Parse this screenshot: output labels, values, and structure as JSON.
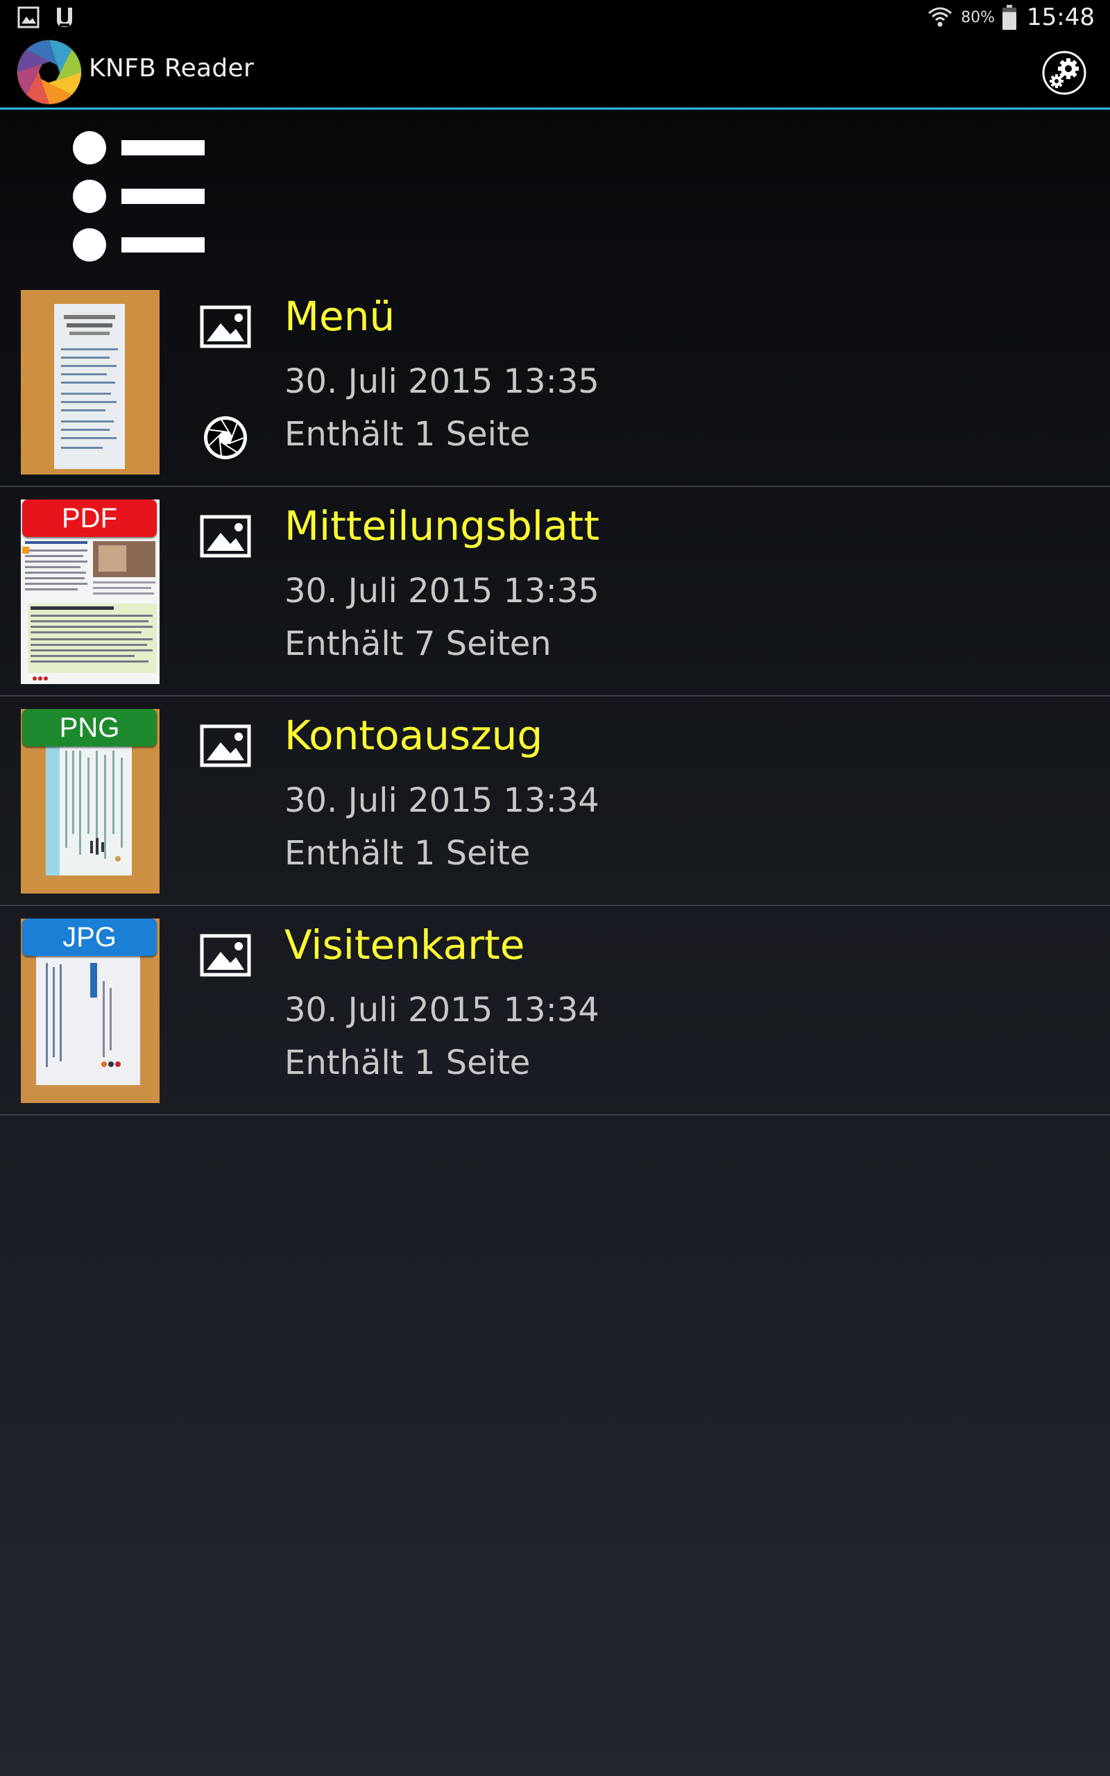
{
  "status_bar": {
    "notification_icons": [
      "gallery-icon",
      "battery-app-icon"
    ],
    "wifi_icon": "wifi-icon",
    "battery_percent": "80%",
    "battery_level": 0.8,
    "time": "15:48"
  },
  "action_bar": {
    "app_title": "KNFB Reader",
    "logo_icon": "aperture-logo-icon",
    "settings_icon": "gears-icon",
    "accent_color": "#33b5e5"
  },
  "list_view_icon": "list-view-icon",
  "documents": [
    {
      "title": "Menü",
      "date": "30. Juli 2015 13:35",
      "pages": "Enthält 1 Seite",
      "badge": "",
      "badge_color": "",
      "type_icon": "image-icon",
      "source_icon": "aperture-icon",
      "thumb_bg": "#c98a3c"
    },
    {
      "title": "Mitteilungsblatt",
      "date": "30. Juli 2015 13:35",
      "pages": "Enthält 7 Seiten",
      "badge": "PDF",
      "badge_color": "#e8141c",
      "type_icon": "image-icon",
      "source_icon": "",
      "thumb_bg": "#f4f4f4"
    },
    {
      "title": "Kontoauszug",
      "date": "30. Juli 2015 13:34",
      "pages": "Enthält 1 Seite",
      "badge": "PNG",
      "badge_color": "#1e8a2e",
      "type_icon": "image-icon",
      "source_icon": "",
      "thumb_bg": "#c7873a"
    },
    {
      "title": "Visitenkarte",
      "date": "30. Juli 2015 13:34",
      "pages": "Enthält 1 Seite",
      "badge": "JPG",
      "badge_color": "#1b7fd6",
      "type_icon": "image-icon",
      "source_icon": "",
      "thumb_bg": "#c4883f"
    }
  ],
  "colors": {
    "title_color": "#ffff33",
    "meta_color": "#c8c8c8",
    "divider_color": "#3a3e45"
  }
}
